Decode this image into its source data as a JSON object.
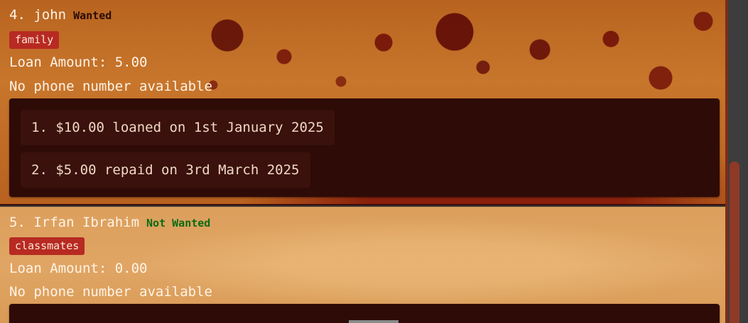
{
  "persons": [
    {
      "name": "4. john",
      "status": "Wanted",
      "tag": "family",
      "loan_amount": "Loan Amount: 5.00",
      "phone": "No phone number available",
      "history": [
        "1. $10.00 loaned on 1st January 2025",
        "2. $5.00 repaid on 3rd March 2025"
      ]
    },
    {
      "name": "5. Irfan Ibrahim",
      "status": "Not Wanted",
      "tag": "classmates",
      "loan_amount": "Loan Amount: 0.00",
      "phone": "No phone number available",
      "history": []
    }
  ],
  "colors": {
    "tag_bg": "#b72a22",
    "status_wanted": "#2a0c06",
    "status_not_wanted": "#0b6b13",
    "history_bg": "#2e0b07",
    "scroll_thumb": "#8e3a26"
  }
}
